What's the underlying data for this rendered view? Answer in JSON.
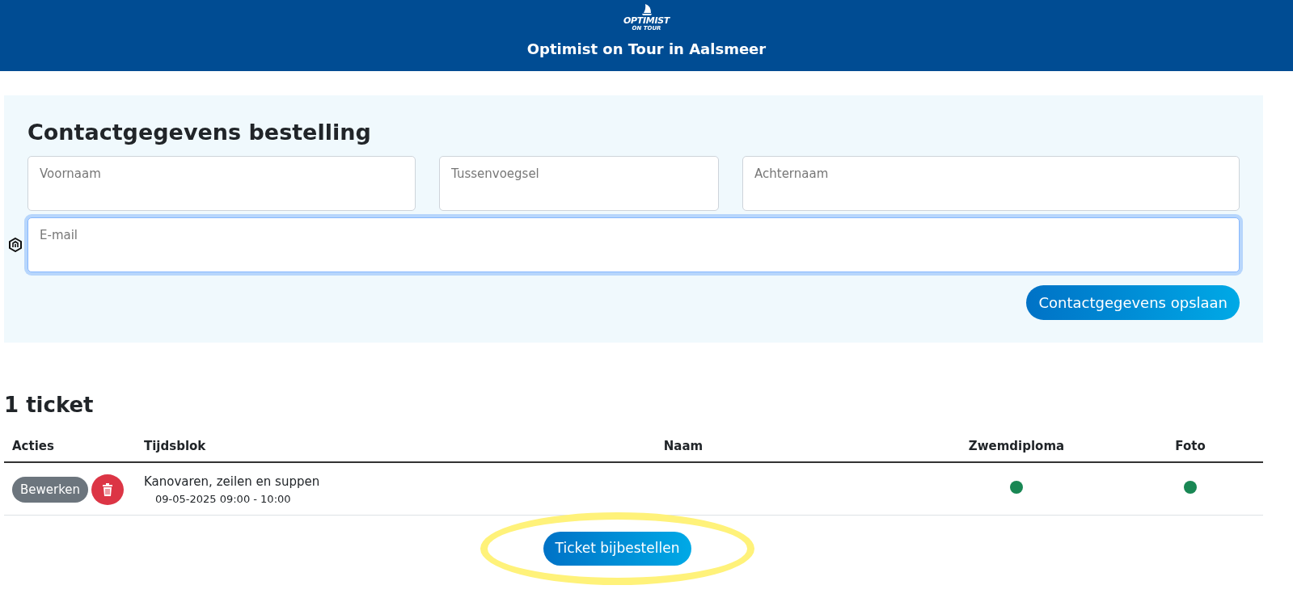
{
  "header": {
    "logo_line_1": "OPTIMIST",
    "logo_line_2": "ON TOUR",
    "title": "Optimist on Tour in Aalsmeer"
  },
  "contact": {
    "heading": "Contactgegevens bestelling",
    "fields": [
      {
        "placeholder": "Voornaam",
        "focused": false
      },
      {
        "placeholder": "Tussenvoegsel",
        "focused": false
      },
      {
        "placeholder": "Achternaam",
        "focused": false
      },
      {
        "placeholder": "E-mail",
        "focused": true
      }
    ],
    "save_button": "Contactgegevens opslaan"
  },
  "tickets": {
    "heading": "1 ticket",
    "columns": [
      "Acties",
      "Tijdsblok",
      "Naam",
      "Zwemdiploma",
      "Foto"
    ],
    "rows": [
      {
        "edit_button": "Bewerken",
        "activity": "Kanovaren, zeilen en suppen",
        "time": "09-05-2025 09:00 - 10:00",
        "indicators": [
          {
            "color": "#198754"
          },
          {
            "color": "#198754"
          }
        ]
      }
    ],
    "order_button": {
      "label": "Ticket bijbestellen",
      "highlighted": true
    }
  }
}
